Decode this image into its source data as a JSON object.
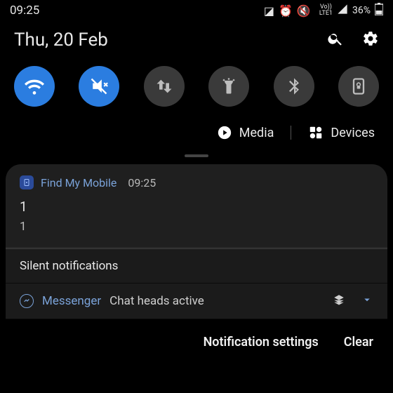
{
  "status": {
    "time": "09:25",
    "battery_pct": "36%",
    "network": "LTE1",
    "vo_label": "Vo))"
  },
  "header": {
    "date": "Thu, 20 Feb"
  },
  "quick_settings": {
    "tiles": [
      {
        "name": "wifi",
        "active": true
      },
      {
        "name": "mute",
        "active": true
      },
      {
        "name": "data",
        "active": false
      },
      {
        "name": "flashlight",
        "active": false
      },
      {
        "name": "bluetooth",
        "active": false
      },
      {
        "name": "lockscreen",
        "active": false
      }
    ]
  },
  "media_devices": {
    "media_label": "Media",
    "devices_label": "Devices"
  },
  "notifications": {
    "card": {
      "app_name": "Find My Mobile",
      "time": "09:25",
      "title": "1",
      "body": "1"
    },
    "silent_header": "Silent notifications",
    "silent_item": {
      "app_name": "Messenger",
      "message": "Chat heads active"
    }
  },
  "footer": {
    "settings_label": "Notification settings",
    "clear_label": "Clear"
  }
}
